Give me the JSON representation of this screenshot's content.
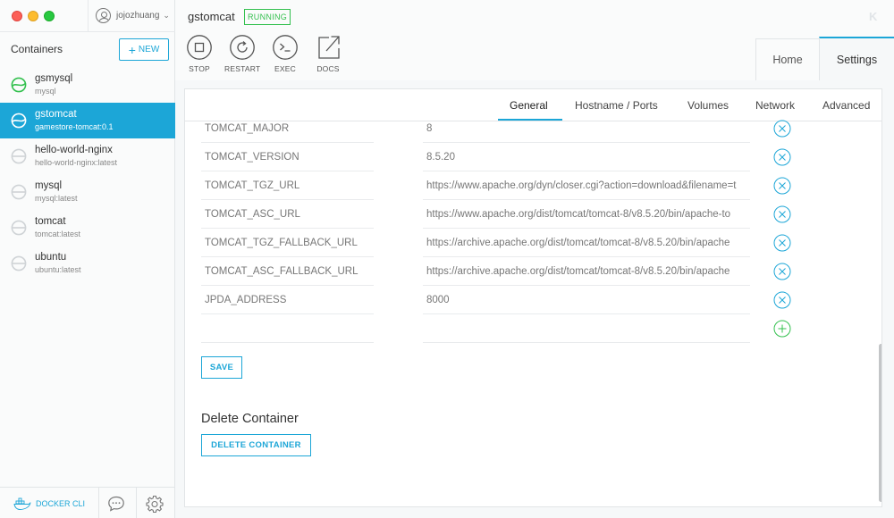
{
  "sidebar": {
    "username": "jojozhuang",
    "containers_heading": "Containers",
    "new_button": "NEW",
    "containers": [
      {
        "name": "gsmysql",
        "image": "mysql",
        "state": "running"
      },
      {
        "name": "gstomcat",
        "image": "gamestore-tomcat:0.1",
        "state": "running-selected"
      },
      {
        "name": "hello-world-nginx",
        "image": "hello-world-nginx:latest",
        "state": "stopped"
      },
      {
        "name": "mysql",
        "image": "mysql:latest",
        "state": "stopped"
      },
      {
        "name": "tomcat",
        "image": "tomcat:latest",
        "state": "stopped"
      },
      {
        "name": "ubuntu",
        "image": "ubuntu:latest",
        "state": "stopped"
      }
    ],
    "docker_cli": "DOCKER CLI"
  },
  "header": {
    "container_name": "gstomcat",
    "status": "RUNNING",
    "logo": "K",
    "toolbar": [
      {
        "label": "STOP",
        "icon": "stop-icon"
      },
      {
        "label": "RESTART",
        "icon": "restart-icon"
      },
      {
        "label": "EXEC",
        "icon": "terminal-icon"
      },
      {
        "label": "DOCS",
        "icon": "external-link-icon"
      }
    ],
    "tabs": {
      "home": "Home",
      "settings": "Settings"
    }
  },
  "settings": {
    "subtabs": [
      "General",
      "Hostname / Ports",
      "Volumes",
      "Network",
      "Advanced"
    ],
    "active_subtab": "General",
    "env_vars": [
      {
        "key": "TOMCAT_MAJOR",
        "value": "8"
      },
      {
        "key": "TOMCAT_VERSION",
        "value": "8.5.20"
      },
      {
        "key": "TOMCAT_TGZ_URL",
        "value": "https://www.apache.org/dyn/closer.cgi?action=download&filename=t"
      },
      {
        "key": "TOMCAT_ASC_URL",
        "value": "https://www.apache.org/dist/tomcat/tomcat-8/v8.5.20/bin/apache-to"
      },
      {
        "key": "TOMCAT_TGZ_FALLBACK_URL",
        "value": "https://archive.apache.org/dist/tomcat/tomcat-8/v8.5.20/bin/apache"
      },
      {
        "key": "TOMCAT_ASC_FALLBACK_URL",
        "value": "https://archive.apache.org/dist/tomcat/tomcat-8/v8.5.20/bin/apache"
      },
      {
        "key": "JPDA_ADDRESS",
        "value": "8000"
      },
      {
        "key": "",
        "value": ""
      }
    ],
    "save_button": "SAVE",
    "delete_heading": "Delete Container",
    "delete_button": "DELETE CONTAINER"
  },
  "colors": {
    "accent": "#1ca6d7",
    "running_green": "#33c04e",
    "stopped_gray": "#cfd3d6"
  }
}
